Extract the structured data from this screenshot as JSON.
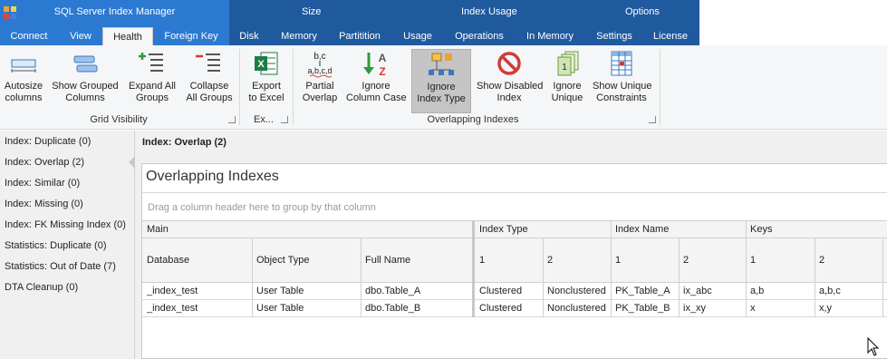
{
  "app": {
    "title": "SQL Server Index Manager"
  },
  "context_groups": [
    "Size",
    "Index Usage",
    "Options"
  ],
  "tabs": [
    "Connect",
    "View",
    "Health",
    "Foreign Key",
    "Disk",
    "Memory",
    "Partitition",
    "Usage",
    "Operations",
    "In Memory",
    "Settings",
    "License"
  ],
  "active_tab": "Health",
  "ribbon": {
    "buttons": {
      "autosize": "Autosize",
      "autosize2": "columns",
      "show_grouped": "Show Grouped",
      "show_grouped2": "Columns",
      "expand": "Expand All",
      "expand2": "Groups",
      "collapse": "Collapse",
      "collapse2": "All Groups",
      "export": "Export",
      "export2": "to Excel",
      "partial": "Partial",
      "partial2": "Overlap",
      "ignore_case": "Ignore",
      "ignore_case2": "Column Case",
      "ignore_type": "Ignore",
      "ignore_type2": "Index Type",
      "show_disabled": "Show Disabled",
      "show_disabled2": "Index",
      "ignore_unique": "Ignore",
      "ignore_unique2": "Unique",
      "show_unique": "Show Unique",
      "show_unique2": "Constraints"
    },
    "groups": {
      "grid_visibility": "Grid Visibility",
      "export": "Ex...",
      "overlapping": "Overlapping Indexes"
    },
    "icon_text": {
      "partial": "b,c",
      "partial_sub": "a,b,c,d",
      "excel": "X",
      "a": "A",
      "z": "Z",
      "unique": "1"
    }
  },
  "nav": [
    "Index: Duplicate (0)",
    "Index: Overlap (2)",
    "Index: Similar (0)",
    "Index: Missing (0)",
    "Index: FK Missing Index (0)",
    "Statistics: Duplicate (0)",
    "Statistics: Out of Date (7)",
    "DTA Cleanup (0)"
  ],
  "main": {
    "header": "Index: Overlap (2)",
    "panel_title": "Overlapping Indexes",
    "groupby_hint": "Drag a column header here to group by that column"
  },
  "grid": {
    "bands": [
      "Main",
      "Index Type",
      "Index Name",
      "Keys"
    ],
    "columns": [
      "Database",
      "Object Type",
      "Full Name",
      "1",
      "2",
      "1",
      "2",
      "1",
      "2"
    ],
    "rows": [
      [
        "_index_test",
        "User Table",
        "dbo.Table_A",
        "Clustered",
        "Nonclustered",
        "PK_Table_A",
        "ix_abc",
        "a,b",
        "a,b,c"
      ],
      [
        "_index_test",
        "User Table",
        "dbo.Table_B",
        "Clustered",
        "Nonclustered",
        "PK_Table_B",
        "ix_xy",
        "x",
        "x,y"
      ]
    ]
  },
  "colors": {
    "brand_blue": "#2b79d0",
    "context_blue": "#1f5a9e",
    "ribbon_bg": "#f5f6f7"
  }
}
